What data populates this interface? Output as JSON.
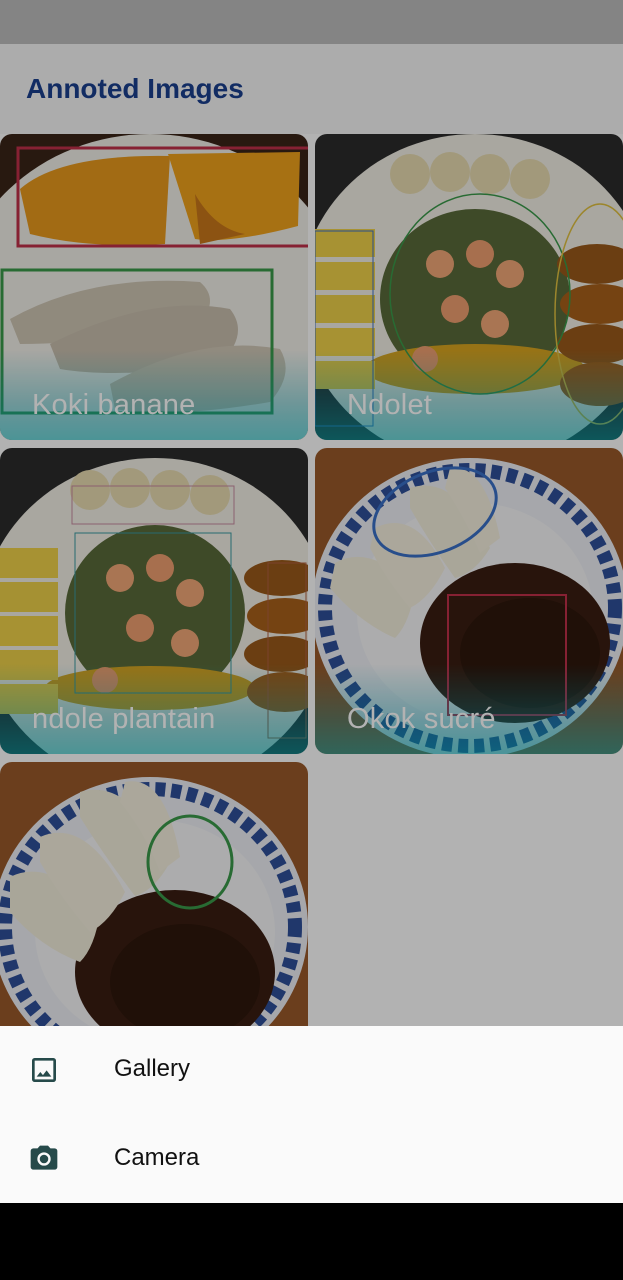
{
  "app": {
    "title": "Annoted Images"
  },
  "images": [
    {
      "label": "Koki banane"
    },
    {
      "label": "Ndolet"
    },
    {
      "label": "ndole plantain"
    },
    {
      "label": "Okok sucré"
    },
    {
      "label": ""
    }
  ],
  "bottom_sheet": {
    "items": [
      {
        "label": "Gallery",
        "icon": "image-icon"
      },
      {
        "label": "Camera",
        "icon": "camera-icon"
      }
    ]
  },
  "colors": {
    "title": "#1a3f8f",
    "icon": "#264a4a",
    "annotation_red": "#c0304a",
    "annotation_green": "#3a9a4a",
    "annotation_blue": "#3a70c8"
  }
}
